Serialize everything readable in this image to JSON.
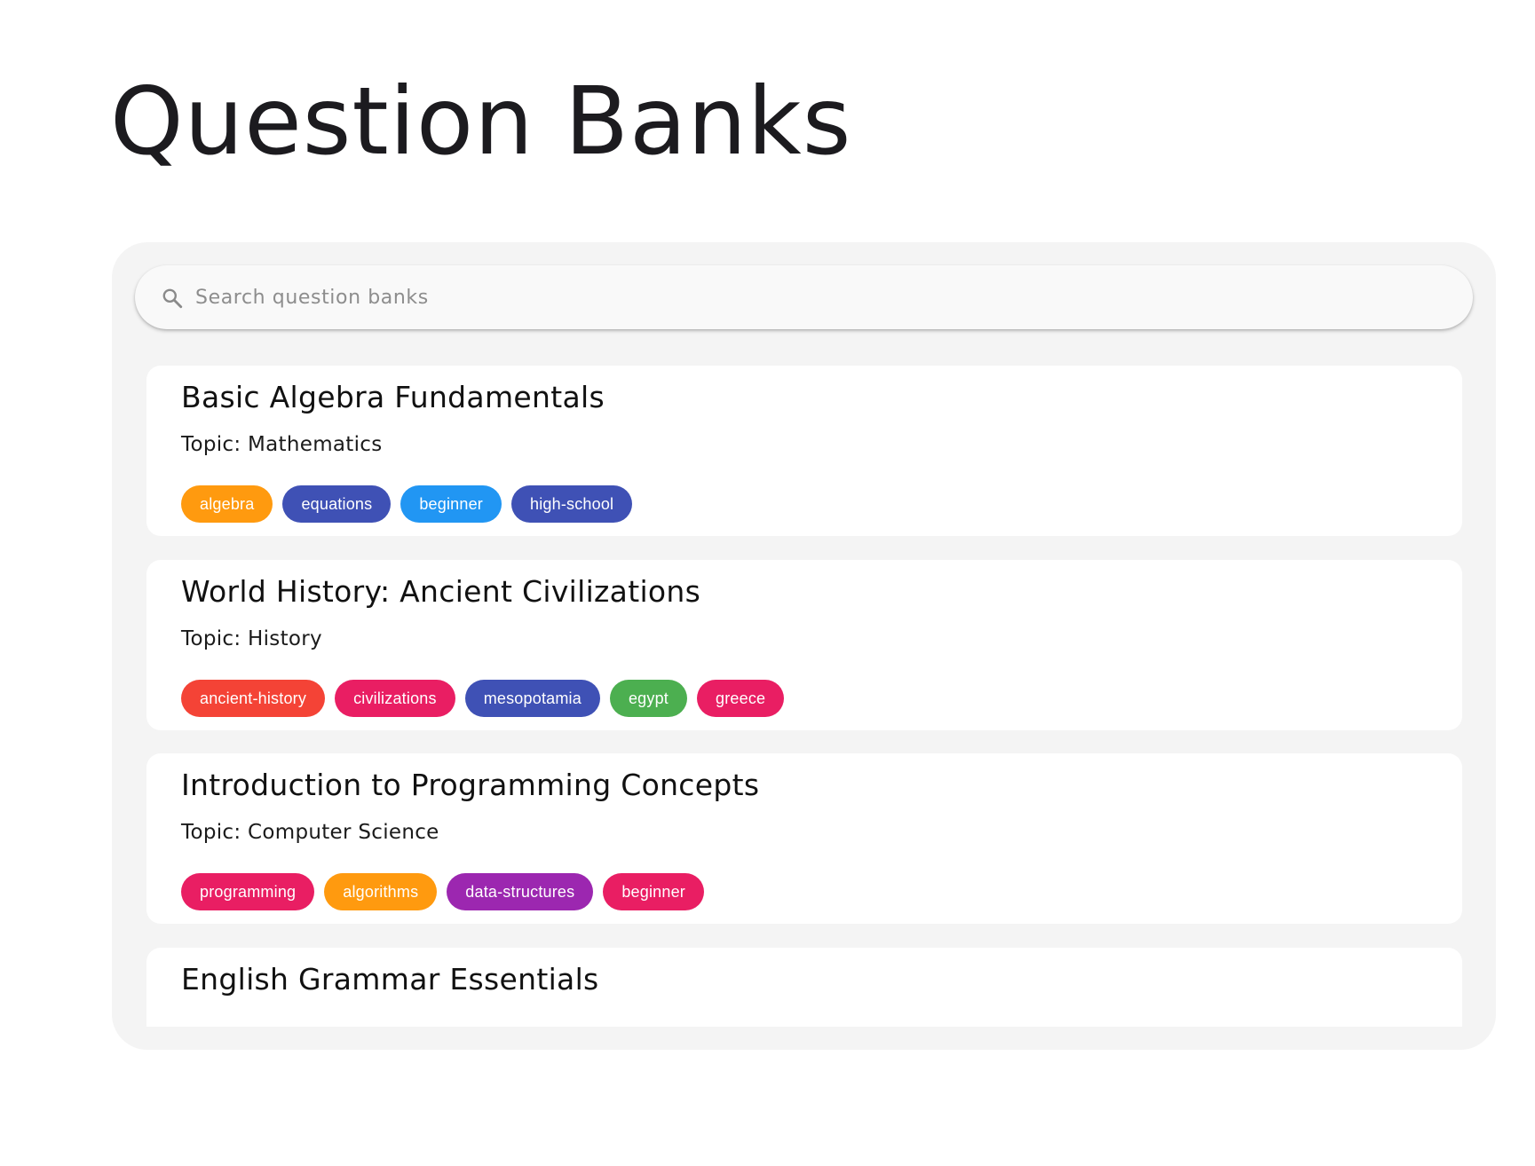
{
  "page": {
    "title": "Question Banks"
  },
  "search": {
    "placeholder": "Search question banks",
    "icon": "search-icon"
  },
  "colors": {
    "orange": "#ff9a0f",
    "indigo": "#3f51b5",
    "blue": "#2196f3",
    "red": "#f44336",
    "pink": "#e91e63",
    "green": "#4caf50",
    "purple": "#9c27b0",
    "panel_bg": "#f4f4f4",
    "card_bg": "#ffffff"
  },
  "banks": [
    {
      "title": "Basic Algebra Fundamentals",
      "topic": "Topic: Mathematics",
      "tags": [
        {
          "label": "algebra",
          "color": "#ff9a0f"
        },
        {
          "label": "equations",
          "color": "#3f51b5"
        },
        {
          "label": "beginner",
          "color": "#2196f3"
        },
        {
          "label": "high-school",
          "color": "#3f51b5"
        }
      ]
    },
    {
      "title": "World History: Ancient Civilizations",
      "topic": "Topic: History",
      "tags": [
        {
          "label": "ancient-history",
          "color": "#f44336"
        },
        {
          "label": "civilizations",
          "color": "#e91e63"
        },
        {
          "label": "mesopotamia",
          "color": "#3f51b5"
        },
        {
          "label": "egypt",
          "color": "#4caf50"
        },
        {
          "label": "greece",
          "color": "#e91e63"
        }
      ]
    },
    {
      "title": "Introduction to Programming Concepts",
      "topic": "Topic: Computer Science",
      "tags": [
        {
          "label": "programming",
          "color": "#e91e63"
        },
        {
          "label": "algorithms",
          "color": "#ff9a0f"
        },
        {
          "label": "data-structures",
          "color": "#9c27b0"
        },
        {
          "label": "beginner",
          "color": "#e91e63"
        }
      ]
    },
    {
      "title": "English Grammar Essentials",
      "topic": "",
      "tags": []
    }
  ]
}
